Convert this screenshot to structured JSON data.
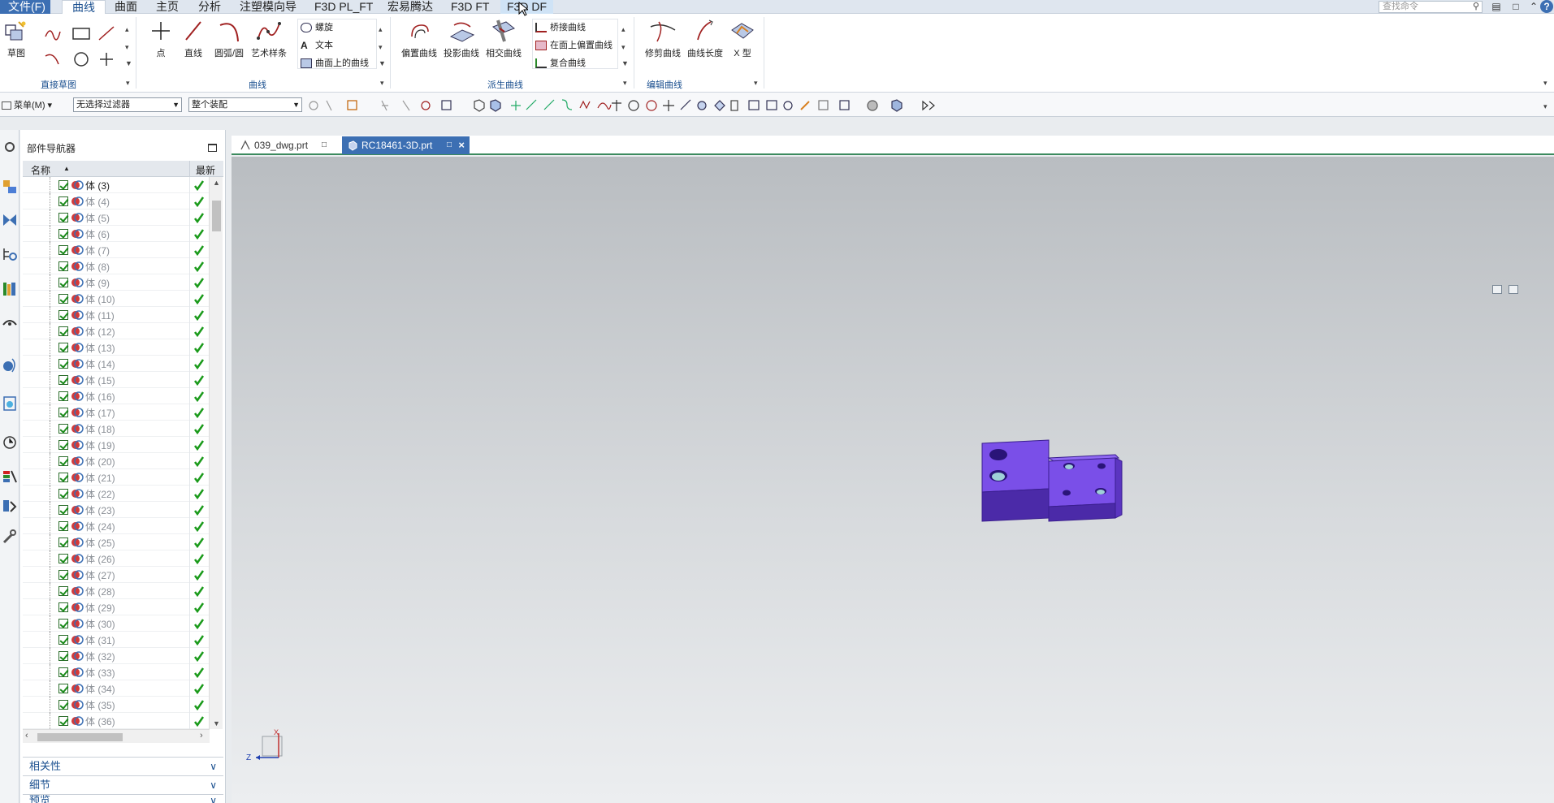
{
  "menubar": {
    "items": [
      "文件(F)",
      "曲线",
      "曲面",
      "主页",
      "分析",
      "注塑模向导",
      "F3D PL_FT",
      "宏易腾达",
      "F3D FT",
      "F3D DF"
    ],
    "search_placeholder": "查找命令"
  },
  "ribbon": {
    "sketch_label": "草图",
    "direct_sketch_group": "直接草图",
    "curve_buttons": [
      "点",
      "直线",
      "圆弧/圆",
      "艺术样条"
    ],
    "curve_small": [
      "螺旋",
      "文本",
      "曲面上的曲线"
    ],
    "curve_group": "曲线",
    "derived_buttons": [
      "偏置曲线",
      "投影曲线",
      "相交曲线"
    ],
    "derived_small": [
      "桥接曲线",
      "在面上偏置曲线",
      "复合曲线"
    ],
    "derived_group": "派生曲线",
    "edit_buttons": [
      "修剪曲线",
      "曲线长度",
      "X 型"
    ],
    "edit_group": "编辑曲线"
  },
  "toolbar": {
    "menu_label": "菜单(M)",
    "filter_value": "无选择过滤器",
    "assembly_value": "整个装配"
  },
  "navigator": {
    "title": "部件导航器",
    "col_name": "名称",
    "col_latest": "最新",
    "rows": [
      "体 (3)",
      "体 (4)",
      "体 (5)",
      "体 (6)",
      "体 (7)",
      "体 (8)",
      "体 (9)",
      "体 (10)",
      "体 (11)",
      "体 (12)",
      "体 (13)",
      "体 (14)",
      "体 (15)",
      "体 (16)",
      "体 (17)",
      "体 (18)",
      "体 (19)",
      "体 (20)",
      "体 (21)",
      "体 (22)",
      "体 (23)",
      "体 (24)",
      "体 (25)",
      "体 (26)",
      "体 (27)",
      "体 (28)",
      "体 (29)",
      "体 (30)",
      "体 (31)",
      "体 (32)",
      "体 (33)",
      "体 (34)",
      "体 (35)",
      "体 (36)"
    ],
    "panels": [
      "相关性",
      "细节",
      "预览"
    ]
  },
  "tabs": [
    "039_dwg.prt",
    "RC18461-3D.prt"
  ],
  "triad": {
    "z": "Z",
    "x": "X"
  },
  "colors": {
    "accent": "#3c6fb3",
    "model": "#6a3fd8",
    "check": "#1a9a1a"
  }
}
